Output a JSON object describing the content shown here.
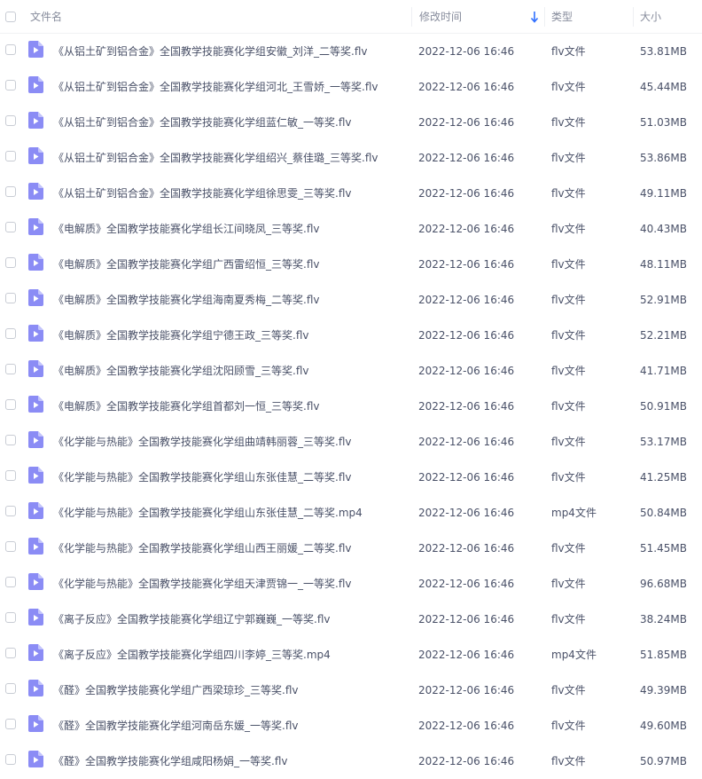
{
  "header": {
    "name_label": "文件名",
    "time_label": "修改时间",
    "type_label": "类型",
    "size_label": "大小",
    "sort_icon": "arrow-down-icon",
    "sort_color": "#2f6fff"
  },
  "file_icon": "video-file-icon",
  "file_icon_color": "#8b8cf5",
  "rows": [
    {
      "name": "《从铝土矿到铝合金》全国教学技能赛化学组安徽_刘洋_二等奖.flv",
      "time": "2022-12-06 16:46",
      "type": "flv文件",
      "size": "53.81MB"
    },
    {
      "name": "《从铝土矿到铝合金》全国教学技能赛化学组河北_王雪娇_一等奖.flv",
      "time": "2022-12-06 16:46",
      "type": "flv文件",
      "size": "45.44MB"
    },
    {
      "name": "《从铝土矿到铝合金》全国教学技能赛化学组蓝仁敏_一等奖.flv",
      "time": "2022-12-06 16:46",
      "type": "flv文件",
      "size": "51.03MB"
    },
    {
      "name": "《从铝土矿到铝合金》全国教学技能赛化学组绍兴_蔡佳璐_三等奖.flv",
      "time": "2022-12-06 16:46",
      "type": "flv文件",
      "size": "53.86MB"
    },
    {
      "name": "《从铝土矿到铝合金》全国教学技能赛化学组徐思雯_三等奖.flv",
      "time": "2022-12-06 16:46",
      "type": "flv文件",
      "size": "49.11MB"
    },
    {
      "name": "《电解质》全国教学技能赛化学组长江间晓凤_三等奖.flv",
      "time": "2022-12-06 16:46",
      "type": "flv文件",
      "size": "40.43MB"
    },
    {
      "name": "《电解质》全国教学技能赛化学组广西雷绍恒_三等奖.flv",
      "time": "2022-12-06 16:46",
      "type": "flv文件",
      "size": "48.11MB"
    },
    {
      "name": "《电解质》全国教学技能赛化学组海南夏秀梅_二等奖.flv",
      "time": "2022-12-06 16:46",
      "type": "flv文件",
      "size": "52.91MB"
    },
    {
      "name": "《电解质》全国教学技能赛化学组宁德王政_三等奖.flv",
      "time": "2022-12-06 16:46",
      "type": "flv文件",
      "size": "52.21MB"
    },
    {
      "name": "《电解质》全国教学技能赛化学组沈阳顾雪_三等奖.flv",
      "time": "2022-12-06 16:46",
      "type": "flv文件",
      "size": "41.71MB"
    },
    {
      "name": "《电解质》全国教学技能赛化学组首都刘一恒_三等奖.flv",
      "time": "2022-12-06 16:46",
      "type": "flv文件",
      "size": "50.91MB"
    },
    {
      "name": "《化学能与热能》全国教学技能赛化学组曲靖韩丽蓉_三等奖.flv",
      "time": "2022-12-06 16:46",
      "type": "flv文件",
      "size": "53.17MB"
    },
    {
      "name": "《化学能与热能》全国教学技能赛化学组山东张佳慧_二等奖.flv",
      "time": "2022-12-06 16:46",
      "type": "flv文件",
      "size": "41.25MB"
    },
    {
      "name": "《化学能与热能》全国教学技能赛化学组山东张佳慧_二等奖.mp4",
      "time": "2022-12-06 16:46",
      "type": "mp4文件",
      "size": "50.84MB"
    },
    {
      "name": "《化学能与热能》全国教学技能赛化学组山西王丽媛_二等奖.flv",
      "time": "2022-12-06 16:46",
      "type": "flv文件",
      "size": "51.45MB"
    },
    {
      "name": "《化学能与热能》全国教学技能赛化学组天津贾锦一_一等奖.flv",
      "time": "2022-12-06 16:46",
      "type": "flv文件",
      "size": "96.68MB"
    },
    {
      "name": "《离子反应》全国教学技能赛化学组辽宁郭巍巍_一等奖.flv",
      "time": "2022-12-06 16:46",
      "type": "flv文件",
      "size": "38.24MB"
    },
    {
      "name": "《离子反应》全国教学技能赛化学组四川李婷_三等奖.mp4",
      "time": "2022-12-06 16:46",
      "type": "mp4文件",
      "size": "51.85MB"
    },
    {
      "name": "《醛》全国教学技能赛化学组广西梁琼珍_三等奖.flv",
      "time": "2022-12-06 16:46",
      "type": "flv文件",
      "size": "49.39MB"
    },
    {
      "name": "《醛》全国教学技能赛化学组河南岳东媛_一等奖.flv",
      "time": "2022-12-06 16:46",
      "type": "flv文件",
      "size": "49.60MB"
    },
    {
      "name": "《醛》全国教学技能赛化学组咸阳杨娟_一等奖.flv",
      "time": "2022-12-06 16:46",
      "type": "flv文件",
      "size": "50.97MB"
    }
  ]
}
